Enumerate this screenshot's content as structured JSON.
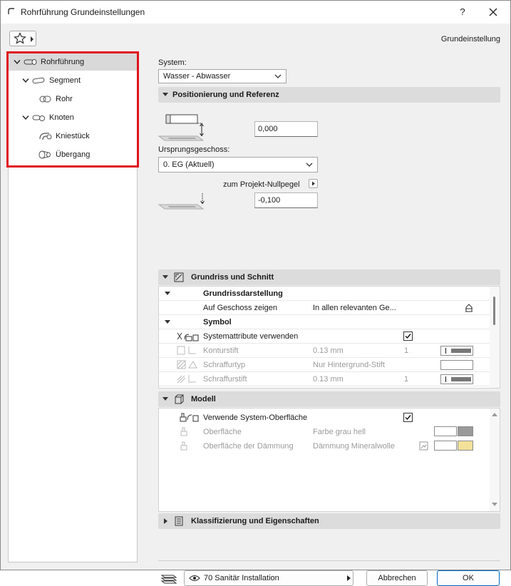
{
  "window": {
    "title": "Rohrführung Grundeinstellungen",
    "help_label": "?",
    "header_right": "Grundeinstellung"
  },
  "tree": {
    "items": [
      {
        "label": "Rohrführung",
        "level": 0,
        "expanded": true,
        "selected": true,
        "icon": "pipe-run-icon"
      },
      {
        "label": "Segment",
        "level": 1,
        "expanded": true,
        "selected": false,
        "icon": "segment-icon"
      },
      {
        "label": "Rohr",
        "level": 2,
        "expanded": null,
        "selected": false,
        "icon": "pipe-icon"
      },
      {
        "label": "Knoten",
        "level": 1,
        "expanded": true,
        "selected": false,
        "icon": "node-icon"
      },
      {
        "label": "Kniestück",
        "level": 2,
        "expanded": null,
        "selected": false,
        "icon": "elbow-icon"
      },
      {
        "label": "Übergang",
        "level": 2,
        "expanded": null,
        "selected": false,
        "icon": "transition-icon"
      }
    ]
  },
  "system": {
    "label": "System:",
    "value": "Wasser - Abwasser"
  },
  "positioning": {
    "title": "Positionierung und Referenz",
    "offset_value": "0,000",
    "origin_story_label": "Ursprungsgeschoss:",
    "origin_story_value": "0. EG (Aktuell)",
    "project_zero_label": "zum Projekt-Nullpegel",
    "project_zero_value": "-0,100"
  },
  "floorplan": {
    "title": "Grundriss und Schnitt",
    "rows": [
      {
        "type": "group",
        "label": "Grundrissdarstellung"
      },
      {
        "type": "row",
        "label": "Auf Geschoss zeigen",
        "value": "In allen relevanten Ge...",
        "extra": ""
      },
      {
        "type": "group",
        "label": "Symbol"
      },
      {
        "type": "row",
        "label": "Systemattribute verwenden",
        "value": "",
        "extra": ""
      },
      {
        "type": "row",
        "label": "Konturstift",
        "value": "0.13 mm",
        "extra": "1"
      },
      {
        "type": "row",
        "label": "Schraffurtyp",
        "value": "Nur Hintergrund-Stift",
        "extra": ""
      },
      {
        "type": "row",
        "label": "Schraffurstift",
        "value": "0.13 mm",
        "extra": "1"
      }
    ],
    "system_attributes_checked": true
  },
  "model": {
    "title": "Modell",
    "use_system_surface_label": "Verwende System-Oberfläche",
    "use_system_surface_checked": true,
    "surface_label": "Oberfläche",
    "surface_value": "Farbe grau hell",
    "insulation_surface_label": "Oberfläche der Dämmung",
    "insulation_surface_value": "Dämmung Mineralwolle"
  },
  "classification": {
    "title": "Klassifizierung und Eigenschaften"
  },
  "footer": {
    "layer_value": "70 Sanitär Installation",
    "cancel_label": "Abbrechen",
    "ok_label": "OK"
  },
  "colors": {
    "highlight_border": "#e0141e",
    "primary_button_border": "#0067c0",
    "surface_gray": "#9a9a9a",
    "insulation_yellow": "#f3e19a"
  }
}
